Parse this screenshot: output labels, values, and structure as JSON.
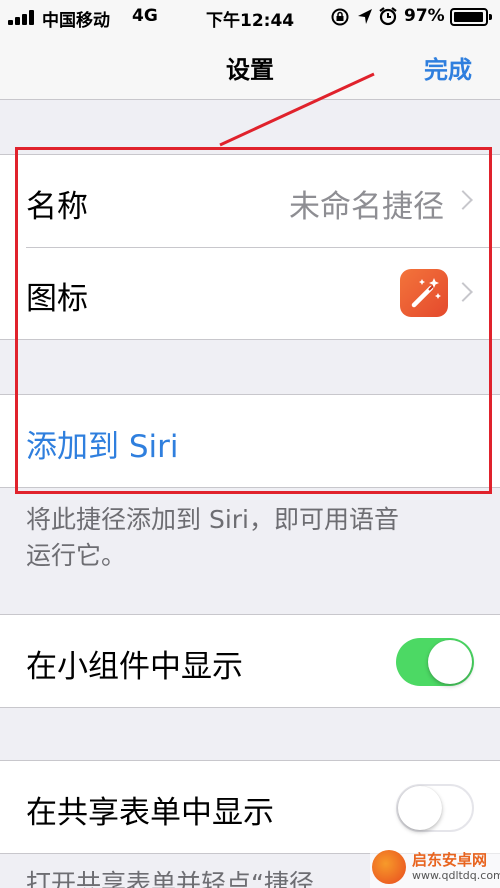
{
  "status_bar": {
    "carrier": "中国移动",
    "network": "4G",
    "time": "下午12:44",
    "battery": "97%",
    "battery_level": 0.97,
    "icons": [
      "signal-icon",
      "rotation-lock-icon",
      "location-icon",
      "alarm-icon",
      "battery-icon"
    ]
  },
  "nav": {
    "title": "设置",
    "done": "完成"
  },
  "shortcut": {
    "name_label": "名称",
    "name_value": "未命名捷径",
    "icon_label": "图标",
    "icon_name": "magic-wand-icon"
  },
  "siri": {
    "add_label": "添加到 Siri",
    "footnote_line1": "将此捷径添加到 Siri，即可用语音",
    "footnote_line2": "运行它。"
  },
  "widget": {
    "label": "在小组件中显示",
    "enabled": true
  },
  "share_sheet": {
    "label": "在共享表单中显示",
    "enabled": false,
    "footnote_partial": "打开共享表单并轻点“捷径"
  },
  "colors": {
    "accent": "#2f7fde",
    "toggle_on": "#4cd964",
    "annotation": "#e0222c",
    "icon_bg": "#ea5630"
  },
  "watermark": {
    "name": "启东安卓网",
    "url": "www.qdltdq.com"
  }
}
